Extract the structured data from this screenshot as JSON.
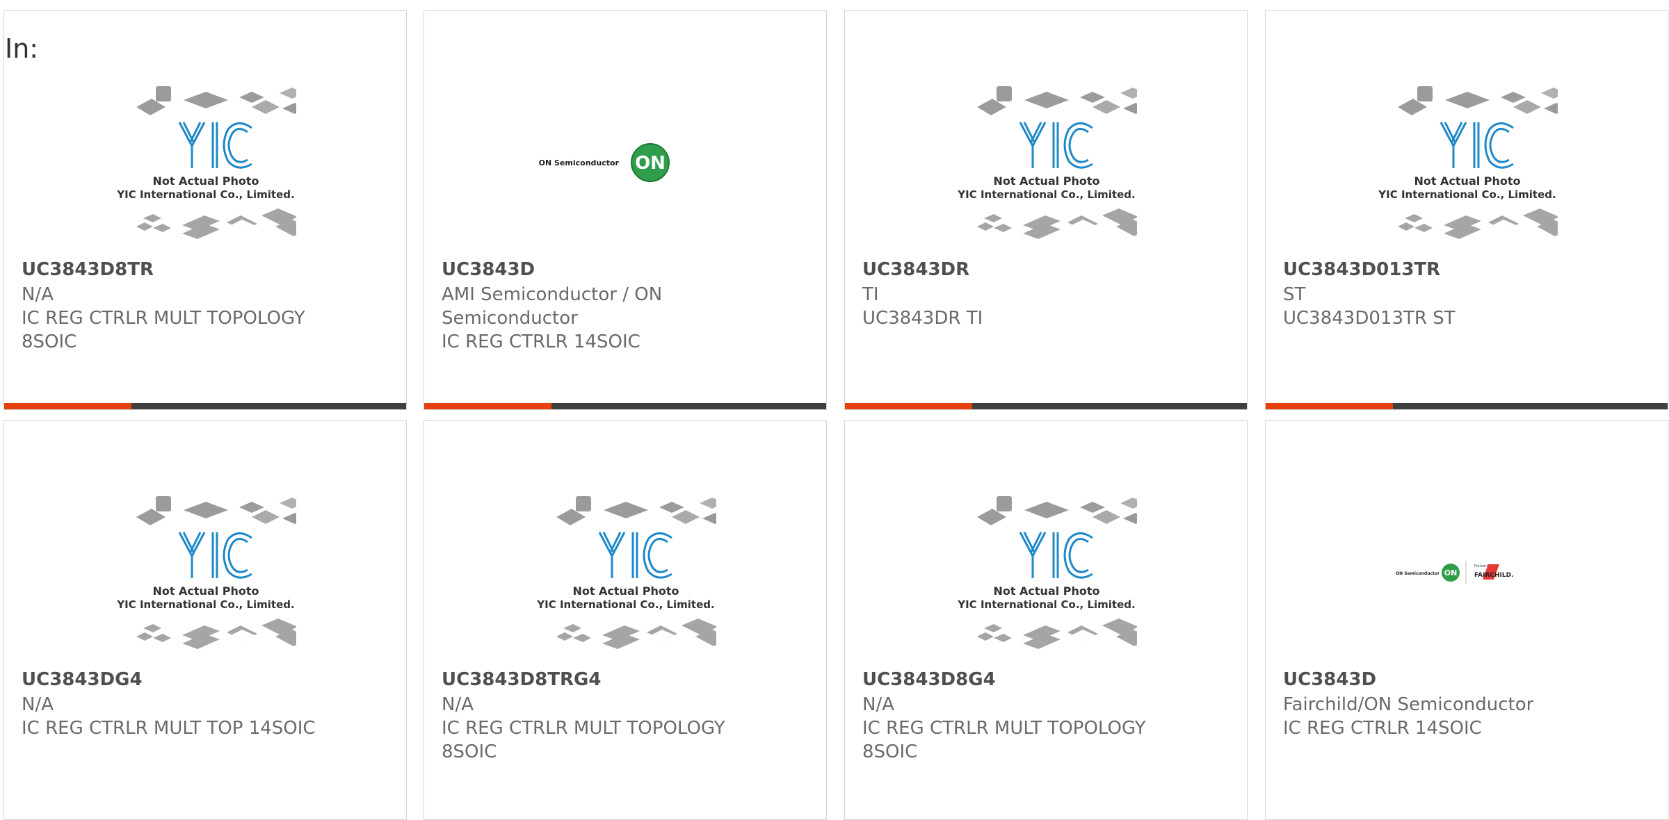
{
  "page": {
    "in_label": "In:"
  },
  "placeholder": {
    "logo": "YIC",
    "line1": "Not Actual Photo",
    "line2": "YIC International Co., Limited."
  },
  "brands": {
    "on_semi": {
      "wordmark": "ON Semiconductor",
      "badge": "ON"
    },
    "fairchild": {
      "formerly": "Formerly",
      "name": "FAIRCHILD."
    }
  },
  "colors": {
    "accent": "#e8400c",
    "bar": "#404040",
    "on_green": "#2e9e4a"
  },
  "products": [
    {
      "part": "UC3843D8TR",
      "lines": [
        "N/A",
        "IC REG CTRLR MULT TOPOLOGY",
        "8SOIC"
      ],
      "image": "yic-placeholder",
      "accent_bar": true
    },
    {
      "part": "UC3843D",
      "lines": [
        "AMI Semiconductor / ON",
        "Semiconductor",
        "IC REG CTRLR 14SOIC"
      ],
      "image": "on-semiconductor-logo",
      "accent_bar": true
    },
    {
      "part": "UC3843DR",
      "lines": [
        "TI",
        "UC3843DR TI"
      ],
      "image": "yic-placeholder",
      "accent_bar": true
    },
    {
      "part": "UC3843D013TR",
      "lines": [
        "ST",
        "UC3843D013TR ST"
      ],
      "image": "yic-placeholder",
      "accent_bar": true
    },
    {
      "part": "UC3843DG4",
      "lines": [
        "N/A",
        "IC REG CTRLR MULT TOP 14SOIC"
      ],
      "image": "yic-placeholder",
      "accent_bar": false
    },
    {
      "part": "UC3843D8TRG4",
      "lines": [
        "N/A",
        "IC REG CTRLR MULT TOPOLOGY",
        "8SOIC"
      ],
      "image": "yic-placeholder",
      "accent_bar": false
    },
    {
      "part": "UC3843D8G4",
      "lines": [
        "N/A",
        "IC REG CTRLR MULT TOPOLOGY",
        "8SOIC"
      ],
      "image": "yic-placeholder",
      "accent_bar": false
    },
    {
      "part": "UC3843D",
      "lines": [
        "Fairchild/ON Semiconductor",
        "IC REG CTRLR 14SOIC"
      ],
      "image": "on-fairchild-logo",
      "accent_bar": false
    }
  ]
}
